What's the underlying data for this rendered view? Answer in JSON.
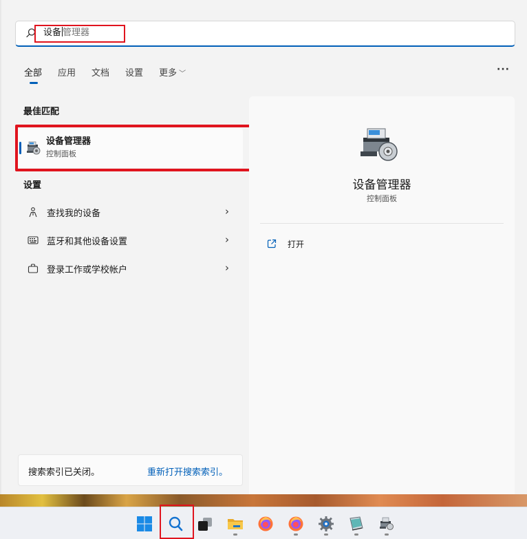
{
  "search": {
    "typed": "设备",
    "hint": "管理器"
  },
  "tabs": [
    {
      "label": "全部",
      "active": true
    },
    {
      "label": "应用",
      "active": false
    },
    {
      "label": "文档",
      "active": false
    },
    {
      "label": "设置",
      "active": false
    },
    {
      "label": "更多",
      "active": false
    }
  ],
  "more_options": "···",
  "best_match": {
    "heading": "最佳匹配",
    "name": "设备管理器",
    "subtitle": "控制面板"
  },
  "settings": {
    "heading": "设置",
    "items": [
      {
        "label": "查找我的设备",
        "icon": "location-person-icon"
      },
      {
        "label": "蓝牙和其他设备设置",
        "icon": "keyboard-icon"
      },
      {
        "label": "登录工作或学校帐户",
        "icon": "briefcase-icon"
      }
    ]
  },
  "index_notice": {
    "text": "搜索索引已关闭。",
    "link": "重新打开搜索索引。"
  },
  "detail": {
    "title": "设备管理器",
    "subtitle": "控制面板",
    "actions": [
      {
        "label": "打开",
        "icon": "open-external-icon"
      }
    ]
  },
  "taskbar": {
    "items": [
      "windows-start-icon",
      "search-icon",
      "task-view-icon",
      "file-explorer-icon",
      "firefox-icon",
      "firefox-icon",
      "settings-gear-icon",
      "notepad-icon",
      "device-manager-icon"
    ]
  },
  "colors": {
    "accent": "#005fb8",
    "highlight": "#e0141e"
  }
}
